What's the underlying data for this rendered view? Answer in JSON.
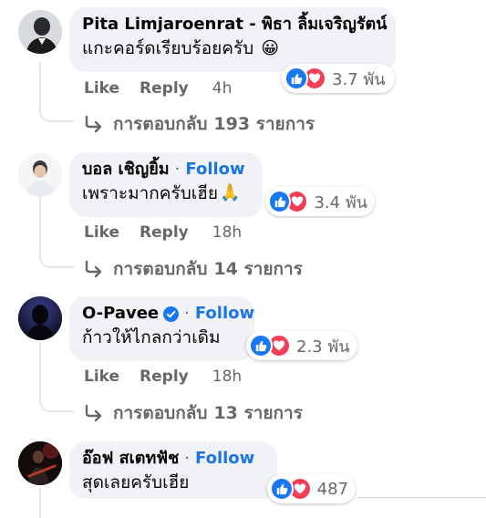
{
  "comments": [
    {
      "author": "Pita Limjaroenrat - พิธา ลิ้มเจริญรัตน์",
      "text": "แกะคอร์ดเรียบร้อยครับ",
      "emoji": "😀",
      "reaction_count": "3.7 พัน",
      "like_label": "Like",
      "reply_label": "Reply",
      "time": "4h",
      "replies_text": "การตอบกลับ",
      "replies_count": "193 รายการ"
    },
    {
      "author": "บอล เชิญยิ้ม",
      "follow_label": "Follow",
      "text": "เพราะมากครับเฮีย",
      "emoji": "🙏",
      "reaction_count": "3.4 พัน",
      "like_label": "Like",
      "reply_label": "Reply",
      "time": "18h",
      "replies_text": "การตอบกลับ",
      "replies_count": "14 รายการ"
    },
    {
      "author": "O-Pavee",
      "verified": true,
      "follow_label": "Follow",
      "text": "ก้าวให้ไกลกว่าเดิม",
      "reaction_count": "2.3 พัน",
      "like_label": "Like",
      "reply_label": "Reply",
      "time": "18h",
      "replies_text": "การตอบกลับ",
      "replies_count": "13 รายการ"
    },
    {
      "author": "อ๊อฟ สเตทฟัช",
      "follow_label": "Follow",
      "text": "สุดเลยครับเฮีย",
      "reaction_count": "487"
    }
  ],
  "colors": {
    "bubble": "#f0f2f5",
    "follow": "#1b74e4",
    "like": "#1877f2",
    "love": "#f33e58",
    "meta": "#65676b",
    "verified": "#1877f2"
  },
  "icons": {
    "like_reaction": "thumbs-up-icon",
    "love_reaction": "heart-icon",
    "reply_arrow": "reply-arrow-icon",
    "verified": "verified-badge-icon"
  }
}
